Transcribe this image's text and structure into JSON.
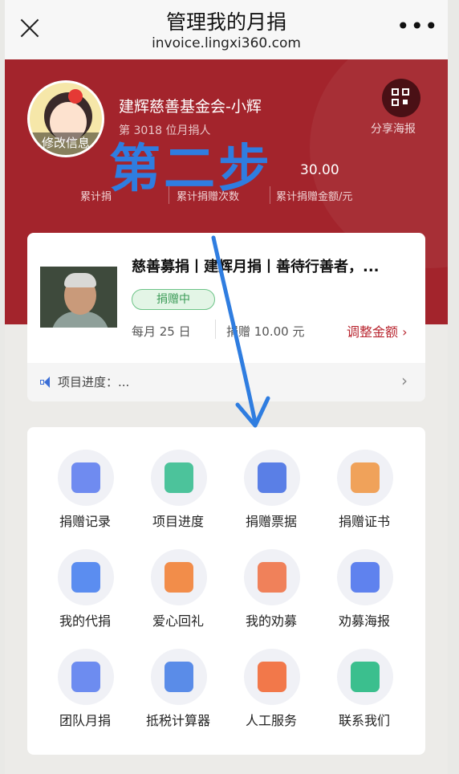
{
  "navbar": {
    "title": "管理我的月捐",
    "url": "invoice.lingxi360.com",
    "more": "•••"
  },
  "profile": {
    "avatar_edit": "修改信息",
    "name": "建辉慈善基金会-小辉",
    "rank": "第 3018 位月捐人",
    "share_label": "分享海报"
  },
  "stats": [
    {
      "value": "",
      "label": "累计捐"
    },
    {
      "value": "",
      "label": "累计捐赠次数"
    },
    {
      "value": "30.00",
      "label": "累计捐赠金额/元"
    }
  ],
  "project": {
    "title": "慈善募捐丨建辉月捐丨善待行善者，...",
    "status": "捐赠中",
    "date": "每月 25 日",
    "amount": "捐赠 10.00 元",
    "adjust": "调整金额 ›",
    "progress_label": "项目进度：...",
    "progress_arrow": "›"
  },
  "grid": [
    {
      "label": "捐赠记录",
      "icon": "donation-record-icon",
      "color": "#6f8bf0"
    },
    {
      "label": "项目进度",
      "icon": "project-progress-icon",
      "color": "#4cc39b"
    },
    {
      "label": "捐赠票据",
      "icon": "donation-receipt-icon",
      "color": "#5a7fe6"
    },
    {
      "label": "捐赠证书",
      "icon": "donation-certificate-icon",
      "color": "#f0a25a"
    },
    {
      "label": "我的代捐",
      "icon": "wallet-icon",
      "color": "#5b8df0"
    },
    {
      "label": "爱心回礼",
      "icon": "gift-icon",
      "color": "#f28d4a"
    },
    {
      "label": "我的劝募",
      "icon": "fundraise-icon",
      "color": "#f0815a"
    },
    {
      "label": "劝募海报",
      "icon": "poster-icon",
      "color": "#5f82ee"
    },
    {
      "label": "团队月捐",
      "icon": "team-calendar-icon",
      "color": "#6d8cf0"
    },
    {
      "label": "抵税计算器",
      "icon": "calculator-icon",
      "color": "#5a8ce8"
    },
    {
      "label": "人工服务",
      "icon": "customer-service-icon",
      "color": "#f2784a"
    },
    {
      "label": "联系我们",
      "icon": "headset-icon",
      "color": "#3bbf8e"
    }
  ],
  "annotation": {
    "text": "第二步",
    "color": "#2f7de0"
  }
}
